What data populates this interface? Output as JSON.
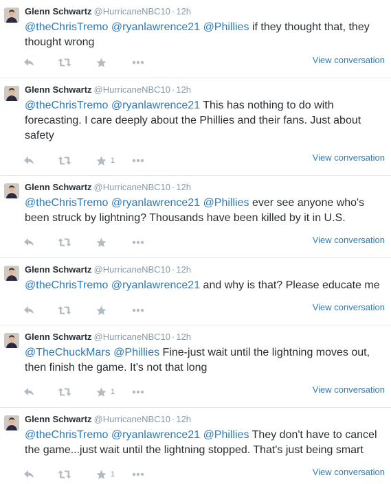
{
  "author": {
    "name": "Glenn Schwartz",
    "handle": "@HurricaneNBC10",
    "separator": "·"
  },
  "view_conversation_label": "View conversation",
  "tweets": [
    {
      "time": "12h",
      "mentions": [
        "@theChrisTremo",
        "@ryanlawrence21",
        "@Phillies"
      ],
      "text": " if they thought that, they thought wrong",
      "favorites": ""
    },
    {
      "time": "12h",
      "mentions": [
        "@theChrisTremo",
        "@ryanlawrence21"
      ],
      "text": " This has nothing to do with forecasting. I care deeply about the Phillies and their fans. Just about safety",
      "favorites": "1"
    },
    {
      "time": "12h",
      "mentions": [
        "@theChrisTremo",
        "@ryanlawrence21",
        "@Phillies"
      ],
      "text": " ever see anyone who's been struck by lightning? Thousands have been killed by it in U.S.",
      "favorites": ""
    },
    {
      "time": "12h",
      "mentions": [
        "@theChrisTremo",
        "@ryanlawrence21"
      ],
      "text": " and why is that? Please educate me",
      "favorites": ""
    },
    {
      "time": "12h",
      "mentions": [
        "@TheChuckMars",
        "@Phillies"
      ],
      "text": " Fine-just wait until the lightning moves out, then finish the game. It's not that long",
      "favorites": "1"
    },
    {
      "time": "12h",
      "mentions": [
        "@theChrisTremo",
        "@ryanlawrence21",
        "@Phillies"
      ],
      "text": " They don't have to cancel the game...just wait until the lightning stopped. That's just being smart",
      "favorites": "1"
    }
  ],
  "icons": {
    "reply": "reply-icon",
    "retweet": "retweet-icon",
    "favorite": "star-icon",
    "more": "more-icon"
  },
  "colors": {
    "link": "#2b7bb9",
    "icon": "#b1bbc3",
    "secondary_text": "#8899a6",
    "divider": "#e1e8ed"
  }
}
